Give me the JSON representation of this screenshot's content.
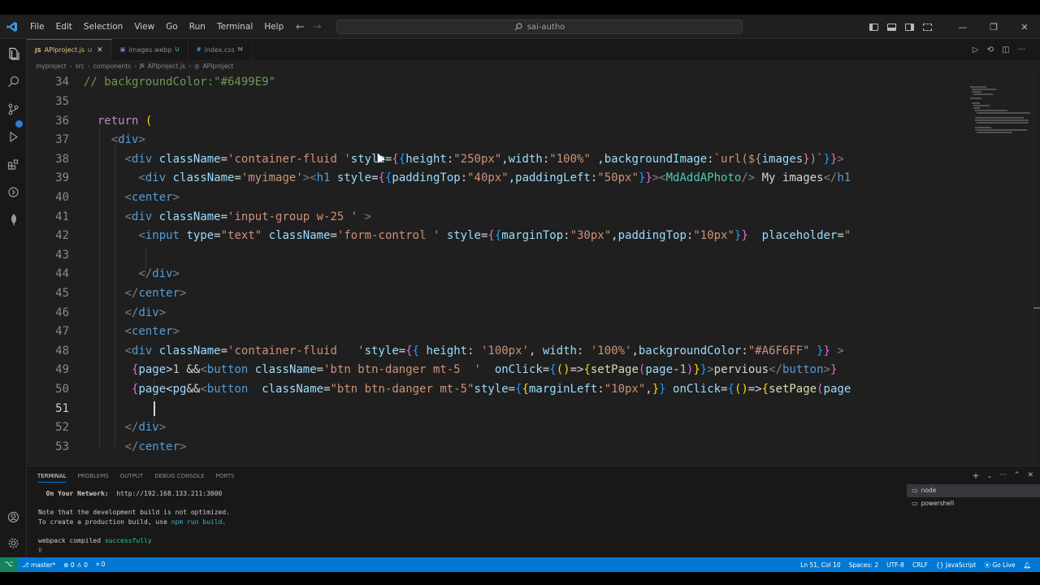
{
  "menu": [
    "File",
    "Edit",
    "Selection",
    "View",
    "Go",
    "Run",
    "Terminal",
    "Help"
  ],
  "search": {
    "text": "sai-autho"
  },
  "tabs": [
    {
      "name": "APIproject.js",
      "status": "U",
      "icon": "JS",
      "active": true
    },
    {
      "name": "images.webp",
      "status": "U",
      "icon": "IMG",
      "active": false
    },
    {
      "name": "index.css",
      "status": "M",
      "icon": "#",
      "active": false
    }
  ],
  "breadcrumb": [
    "myproject",
    "src",
    "components",
    "APIproject.js",
    "APIproject"
  ],
  "editor": {
    "line_numbers": [
      "34",
      "35",
      "36",
      "37",
      "38",
      "39",
      "40",
      "41",
      "42",
      "43",
      "44",
      "45",
      "46",
      "47",
      "48",
      "49",
      "50",
      "51",
      "52",
      "53"
    ],
    "current_line": "51",
    "lines": [
      [
        [
          "t-com",
          "// backgroundColor:\"#6499E9\""
        ]
      ],
      [],
      [
        [
          "t-punc",
          "  "
        ],
        [
          "t-kw",
          "return"
        ],
        [
          "t-punc",
          " "
        ],
        [
          "t-brace1",
          "("
        ]
      ],
      [
        [
          "t-punc",
          "    "
        ],
        [
          "t-br",
          "<"
        ],
        [
          "t-tag",
          "div"
        ],
        [
          "t-br",
          ">"
        ]
      ],
      [
        [
          "t-punc",
          "      "
        ],
        [
          "t-br",
          "<"
        ],
        [
          "t-tag",
          "div"
        ],
        [
          "t-punc",
          " "
        ],
        [
          "t-attr",
          "className"
        ],
        [
          "t-punc",
          "="
        ],
        [
          "t-str",
          "'container-fluid '"
        ],
        [
          "t-attr",
          "style"
        ],
        [
          "t-punc",
          "="
        ],
        [
          "t-brace2",
          "{"
        ],
        [
          "t-brace3",
          "{"
        ],
        [
          "t-attr",
          "height"
        ],
        [
          "t-punc",
          ":"
        ],
        [
          "t-str",
          "\"250px\""
        ],
        [
          "t-punc",
          ","
        ],
        [
          "t-attr",
          "width"
        ],
        [
          "t-punc",
          ":"
        ],
        [
          "t-str",
          "\"100%\""
        ],
        [
          "t-punc",
          " ,"
        ],
        [
          "t-attr",
          "backgroundImage"
        ],
        [
          "t-punc",
          ":"
        ],
        [
          "t-str",
          "`url(${"
        ],
        [
          "t-attr",
          "images"
        ],
        [
          "t-str",
          "})`"
        ],
        [
          "t-brace3",
          "}"
        ],
        [
          "t-brace2",
          "}"
        ],
        [
          "t-br",
          ">"
        ]
      ],
      [
        [
          "t-punc",
          "        "
        ],
        [
          "t-br",
          "<"
        ],
        [
          "t-tag",
          "div"
        ],
        [
          "t-punc",
          " "
        ],
        [
          "t-attr",
          "className"
        ],
        [
          "t-punc",
          "="
        ],
        [
          "t-str",
          "'myimage'"
        ],
        [
          "t-br",
          "><"
        ],
        [
          "t-tag",
          "h1"
        ],
        [
          "t-punc",
          " "
        ],
        [
          "t-attr",
          "style"
        ],
        [
          "t-punc",
          "="
        ],
        [
          "t-brace2",
          "{"
        ],
        [
          "t-brace3",
          "{"
        ],
        [
          "t-attr",
          "paddingTop"
        ],
        [
          "t-punc",
          ":"
        ],
        [
          "t-str",
          "\"40px\""
        ],
        [
          "t-punc",
          ","
        ],
        [
          "t-attr",
          "paddingLeft"
        ],
        [
          "t-punc",
          ":"
        ],
        [
          "t-str",
          "\"50px\""
        ],
        [
          "t-brace3",
          "}"
        ],
        [
          "t-brace2",
          "}"
        ],
        [
          "t-br",
          "><"
        ],
        [
          "t-comp",
          "MdAddAPhoto"
        ],
        [
          "t-br",
          "/>"
        ],
        [
          "t-punc",
          " My images"
        ],
        [
          "t-br",
          "</"
        ],
        [
          "t-tag",
          "h1"
        ]
      ],
      [
        [
          "t-punc",
          "      "
        ],
        [
          "t-br",
          "<"
        ],
        [
          "t-tag",
          "center"
        ],
        [
          "t-br",
          ">"
        ]
      ],
      [
        [
          "t-punc",
          "      "
        ],
        [
          "t-br",
          "<"
        ],
        [
          "t-tag",
          "div"
        ],
        [
          "t-punc",
          " "
        ],
        [
          "t-attr",
          "className"
        ],
        [
          "t-punc",
          "="
        ],
        [
          "t-str",
          "'input-group w-25 '"
        ],
        [
          "t-punc",
          " "
        ],
        [
          "t-br",
          ">"
        ]
      ],
      [
        [
          "t-punc",
          "        "
        ],
        [
          "t-br",
          "<"
        ],
        [
          "t-tag",
          "input"
        ],
        [
          "t-punc",
          " "
        ],
        [
          "t-attr",
          "type"
        ],
        [
          "t-punc",
          "="
        ],
        [
          "t-str",
          "\"text\""
        ],
        [
          "t-punc",
          " "
        ],
        [
          "t-attr",
          "className"
        ],
        [
          "t-punc",
          "="
        ],
        [
          "t-str",
          "'form-control '"
        ],
        [
          "t-punc",
          " "
        ],
        [
          "t-attr",
          "style"
        ],
        [
          "t-punc",
          "="
        ],
        [
          "t-brace2",
          "{"
        ],
        [
          "t-brace3",
          "{"
        ],
        [
          "t-attr",
          "marginTop"
        ],
        [
          "t-punc",
          ":"
        ],
        [
          "t-str",
          "\"30px\""
        ],
        [
          "t-punc",
          ","
        ],
        [
          "t-attr",
          "paddingTop"
        ],
        [
          "t-punc",
          ":"
        ],
        [
          "t-str",
          "\"10px\""
        ],
        [
          "t-brace3",
          "}"
        ],
        [
          "t-brace2",
          "}"
        ],
        [
          "t-punc",
          "  "
        ],
        [
          "t-attr",
          "placeholder"
        ],
        [
          "t-punc",
          "="
        ],
        [
          "t-str",
          "\""
        ]
      ],
      [],
      [
        [
          "t-punc",
          "        "
        ],
        [
          "t-br",
          "</"
        ],
        [
          "t-tag",
          "div"
        ],
        [
          "t-br",
          ">"
        ]
      ],
      [
        [
          "t-punc",
          "      "
        ],
        [
          "t-br",
          "</"
        ],
        [
          "t-tag",
          "center"
        ],
        [
          "t-br",
          ">"
        ]
      ],
      [
        [
          "t-punc",
          "      "
        ],
        [
          "t-br",
          "</"
        ],
        [
          "t-tag",
          "div"
        ],
        [
          "t-br",
          ">"
        ]
      ],
      [
        [
          "t-punc",
          "      "
        ],
        [
          "t-br",
          "<"
        ],
        [
          "t-tag",
          "center"
        ],
        [
          "t-br",
          ">"
        ]
      ],
      [
        [
          "t-punc",
          "      "
        ],
        [
          "t-br",
          "<"
        ],
        [
          "t-tag",
          "div"
        ],
        [
          "t-punc",
          " "
        ],
        [
          "t-attr",
          "className"
        ],
        [
          "t-punc",
          "="
        ],
        [
          "t-str",
          "'container-fluid   '"
        ],
        [
          "t-attr",
          "style"
        ],
        [
          "t-punc",
          "="
        ],
        [
          "t-brace2",
          "{"
        ],
        [
          "t-brace3",
          "{"
        ],
        [
          "t-punc",
          " "
        ],
        [
          "t-attr",
          "height"
        ],
        [
          "t-punc",
          ": "
        ],
        [
          "t-str",
          "'100px'"
        ],
        [
          "t-punc",
          ", "
        ],
        [
          "t-attr",
          "width"
        ],
        [
          "t-punc",
          ": "
        ],
        [
          "t-str",
          "'100%'"
        ],
        [
          "t-punc",
          ","
        ],
        [
          "t-attr",
          "backgroundColor"
        ],
        [
          "t-punc",
          ":"
        ],
        [
          "t-str",
          "\"#A6F6FF\""
        ],
        [
          "t-punc",
          " "
        ],
        [
          "t-brace3",
          "}"
        ],
        [
          "t-brace2",
          "}"
        ],
        [
          "t-punc",
          " "
        ],
        [
          "t-br",
          ">"
        ]
      ],
      [
        [
          "t-punc",
          "       "
        ],
        [
          "t-brace2",
          "{"
        ],
        [
          "t-attr",
          "page"
        ],
        [
          "t-punc",
          ">"
        ],
        [
          "t-num",
          "1"
        ],
        [
          "t-punc",
          " &&"
        ],
        [
          "t-br",
          "<"
        ],
        [
          "t-tag",
          "button"
        ],
        [
          "t-punc",
          " "
        ],
        [
          "t-attr",
          "className"
        ],
        [
          "t-punc",
          "="
        ],
        [
          "t-str",
          "'btn btn-danger mt-5  '"
        ],
        [
          "t-punc",
          "  "
        ],
        [
          "t-attr",
          "onClick"
        ],
        [
          "t-punc",
          "="
        ],
        [
          "t-brace3",
          "{"
        ],
        [
          "t-brace1",
          "()"
        ],
        [
          "t-punc",
          "=>"
        ],
        [
          "t-brace1",
          "{"
        ],
        [
          "t-fn",
          "setPage"
        ],
        [
          "t-brace2",
          "("
        ],
        [
          "t-attr",
          "page"
        ],
        [
          "t-punc",
          "-"
        ],
        [
          "t-num",
          "1"
        ],
        [
          "t-brace2",
          ")"
        ],
        [
          "t-brace1",
          "}"
        ],
        [
          "t-brace3",
          "}"
        ],
        [
          "t-br",
          ">"
        ],
        [
          "t-punc",
          "pervious"
        ],
        [
          "t-br",
          "</"
        ],
        [
          "t-tag",
          "button"
        ],
        [
          "t-br",
          ">"
        ],
        [
          "t-brace2",
          "}"
        ]
      ],
      [
        [
          "t-punc",
          "       "
        ],
        [
          "t-brace2",
          "{"
        ],
        [
          "t-attr",
          "page"
        ],
        [
          "t-punc",
          "<"
        ],
        [
          "t-attr",
          "pg"
        ],
        [
          "t-punc",
          "&&"
        ],
        [
          "t-br",
          "<"
        ],
        [
          "t-tag",
          "button"
        ],
        [
          "t-punc",
          "  "
        ],
        [
          "t-attr",
          "className"
        ],
        [
          "t-punc",
          "="
        ],
        [
          "t-str",
          "\"btn btn-danger mt-5\""
        ],
        [
          "t-attr",
          "style"
        ],
        [
          "t-punc",
          "="
        ],
        [
          "t-brace3",
          "{"
        ],
        [
          "t-brace1",
          "{"
        ],
        [
          "t-attr",
          "marginLeft"
        ],
        [
          "t-punc",
          ":"
        ],
        [
          "t-str",
          "\"10px\""
        ],
        [
          "t-punc",
          ","
        ],
        [
          "t-brace1",
          "}"
        ],
        [
          "t-brace3",
          "}"
        ],
        [
          "t-punc",
          " "
        ],
        [
          "t-attr",
          "onClick"
        ],
        [
          "t-punc",
          "="
        ],
        [
          "t-brace3",
          "{"
        ],
        [
          "t-brace1",
          "()"
        ],
        [
          "t-punc",
          "=>"
        ],
        [
          "t-brace1",
          "{"
        ],
        [
          "t-fn",
          "setPage"
        ],
        [
          "t-brace2",
          "("
        ],
        [
          "t-attr",
          "page"
        ]
      ],
      [],
      [
        [
          "t-punc",
          "      "
        ],
        [
          "t-br",
          "</"
        ],
        [
          "t-tag",
          "div"
        ],
        [
          "t-br",
          ">"
        ]
      ],
      [
        [
          "t-punc",
          "      "
        ],
        [
          "t-br",
          "</"
        ],
        [
          "t-tag",
          "center"
        ],
        [
          "t-br",
          ">"
        ]
      ]
    ]
  },
  "panel": {
    "tabs": [
      "TERMINAL",
      "PROBLEMS",
      "OUTPUT",
      "DEBUG CONSOLE",
      "PORTS"
    ],
    "terminal_lines": [
      [
        [
          "term-bold",
          "  On Your Network:  "
        ],
        [
          "",
          "http://192.168.133.211:3000"
        ]
      ],
      [
        [
          "",
          ""
        ]
      ],
      [
        [
          "",
          "Note that the development build is not optimized."
        ]
      ],
      [
        [
          "",
          "To create a production build, use "
        ],
        [
          "term-cyan",
          "npm run build"
        ],
        [
          "",
          "."
        ]
      ],
      [
        [
          "",
          ""
        ]
      ],
      [
        [
          "",
          "webpack compiled "
        ],
        [
          "term-green",
          "successfully"
        ]
      ],
      [
        [
          "",
          "▯"
        ]
      ]
    ],
    "terminals": [
      "node",
      "powershell"
    ]
  },
  "statusbar": {
    "branch": "master*",
    "errors": "0",
    "warnings": "0",
    "ports": "0",
    "position": "Ln 51, Col 10",
    "spaces": "Spaces: 2",
    "encoding": "UTF-8",
    "eol": "CRLF",
    "language": "JavaScript",
    "golive": "Go Live"
  },
  "colors": {
    "accent": "#0078d4",
    "editor_bg": "#1f1f1f",
    "remote": "#16825d"
  }
}
